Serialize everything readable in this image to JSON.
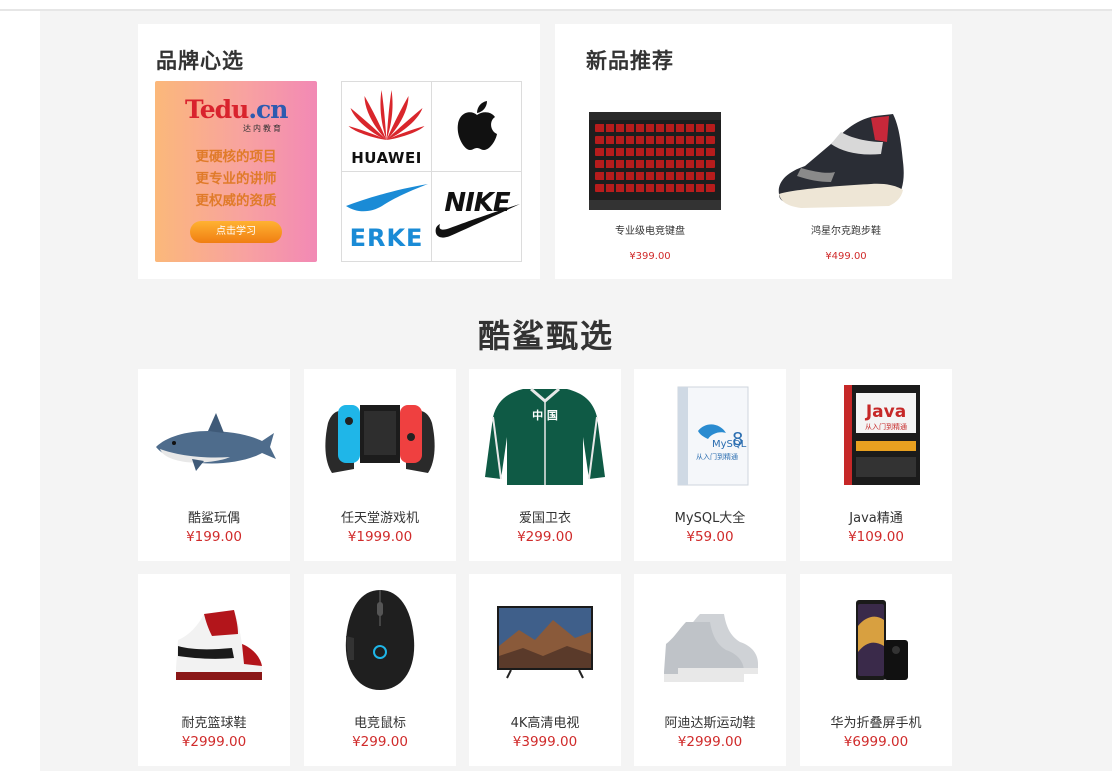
{
  "brand_section": {
    "title": "品牌心选",
    "promo": {
      "logo_t": "Tedu",
      "logo_d": ".cn",
      "logo_sub": "达内教育",
      "lines": [
        "更硬核的项目",
        "更专业的讲师",
        "更权威的资质"
      ],
      "button": "点击学习"
    },
    "brands": [
      "HUAWEI",
      "ERKE",
      "NIKE"
    ]
  },
  "new_section": {
    "title": "新品推荐",
    "items": [
      {
        "name": "专业级电竞键盘",
        "price": "¥399.00"
      },
      {
        "name": "鸿星尔克跑步鞋",
        "price": "¥499.00"
      }
    ]
  },
  "featured": {
    "title": "酷鲨甄选",
    "products": [
      {
        "name": "酷鲨玩偶",
        "price": "¥199.00"
      },
      {
        "name": "任天堂游戏机",
        "price": "¥1999.00"
      },
      {
        "name": "爱国卫衣",
        "price": "¥299.00"
      },
      {
        "name": "MySQL大全",
        "price": "¥59.00"
      },
      {
        "name": "Java精通",
        "price": "¥109.00"
      },
      {
        "name": "耐克篮球鞋",
        "price": "¥2999.00"
      },
      {
        "name": "电竞鼠标",
        "price": "¥299.00"
      },
      {
        "name": "4K高清电视",
        "price": "¥3999.00"
      },
      {
        "name": "阿迪达斯运动鞋",
        "price": "¥2999.00"
      },
      {
        "name": "华为折叠屏手机",
        "price": "¥6999.00"
      }
    ],
    "product_art": {
      "jacket_text": "中   国",
      "mysql_cover": "MySQL",
      "mysql_version": "8",
      "mysql_tag": "从入门到精通",
      "java_cover": "Java",
      "java_tag": "从入门到精通"
    }
  },
  "colors": {
    "price": "#d02b2b",
    "promo_accent": "#e07b2a",
    "background": "#f4f4f4"
  }
}
